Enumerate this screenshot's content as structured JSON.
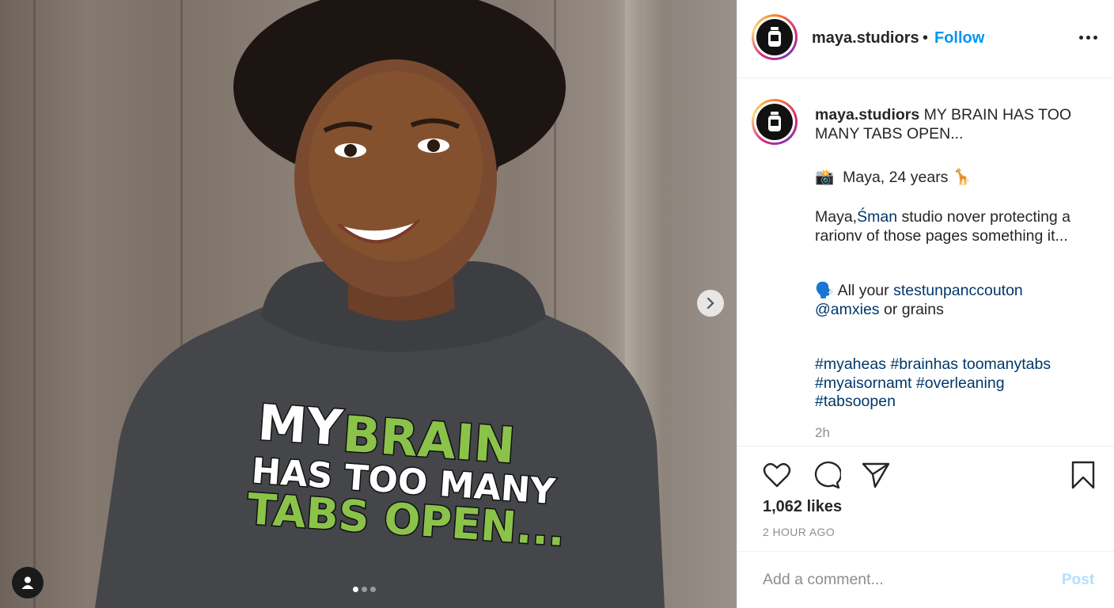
{
  "post": {
    "media": {
      "shirt_text": {
        "line1_a": "MY",
        "line1_b": "BRAIN",
        "line2": "HAS TOO MANY",
        "line3": "TABS OPEN..."
      },
      "carousel": {
        "dots": 3,
        "active_index": 0
      },
      "icons": {
        "next": "chevron-right-icon",
        "tags": "user-tag-icon"
      }
    },
    "header": {
      "username": "maya.studiors",
      "separator": "•",
      "follow_label": "Follow",
      "more_icon": "more-options-icon"
    },
    "caption": {
      "username": "maya.studiors",
      "title": "MY BRAIN HAS TOO MANY TABS OPEN...",
      "line_intro_emoji": "📸",
      "line_intro": "Maya, 24 years",
      "line_intro_end_emoji": "🦒",
      "para1_prefix": "Maya,",
      "para1_link": "Śman",
      "para1_rest": "studio nover protecting a rarionv of those pages something it...",
      "para2_emoji": "🗣️",
      "para2_prefix": "All your",
      "para2_link": "stestunpanccouton",
      "para2_mention": "@amxies",
      "para2_rest": "or grains",
      "hashtags_line1": "#myaheas #brainhas toomanytabs",
      "hashtags_line2": "#myaisornamt #overleaning",
      "hashtags_line3": "#tabsoopen",
      "time": "2h"
    },
    "actions": {
      "like_icon": "heart-icon",
      "comment_icon": "comment-icon",
      "share_icon": "send-icon",
      "save_icon": "bookmark-icon",
      "likes": "1,062 likes",
      "posted": "2 HOUR AGO"
    },
    "comment": {
      "placeholder": "Add a comment...",
      "post_label": "Post"
    },
    "colors": {
      "follow": "#0095f6",
      "link": "#00376b",
      "post_disabled": "#b2dffc",
      "shirt_green": "#8bc34a"
    }
  }
}
